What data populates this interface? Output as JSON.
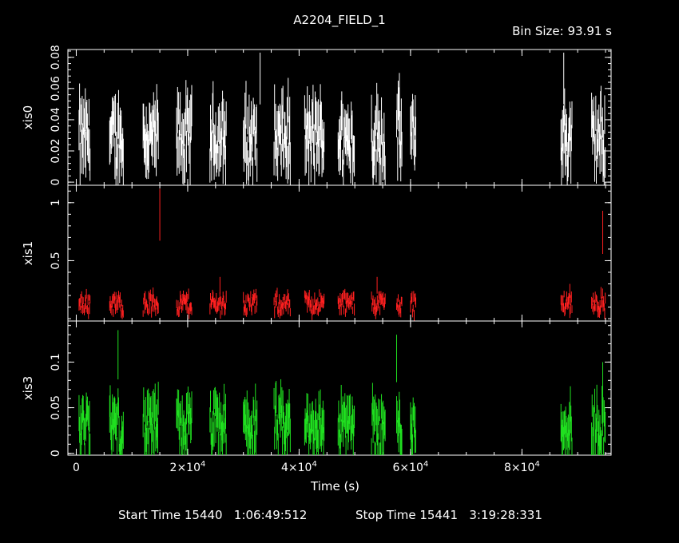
{
  "title": "A2204_FIELD_1",
  "bin_size": "Bin Size: 93.91 s",
  "x_label": "Time (s)",
  "start_label": "Start Time 15440   1:06:49:512",
  "stop_label": "Stop Time 15441   3:19:28:331",
  "colors": {
    "xis0": "#ffffff",
    "xis1": "#ff2020",
    "xis3": "#20e020",
    "frame": "#ffffff"
  },
  "chart_data": {
    "type": "scatter",
    "xlim": [
      -1500,
      96000
    ],
    "x_ticks": [
      {
        "v": 0,
        "label": "0"
      },
      {
        "v": 20000,
        "label": "2×10",
        "exp": "4"
      },
      {
        "v": 40000,
        "label": "4×10",
        "exp": "4"
      },
      {
        "v": 60000,
        "label": "6×10",
        "exp": "4"
      },
      {
        "v": 80000,
        "label": "8×10",
        "exp": "4"
      }
    ],
    "segments": [
      [
        500,
        2500
      ],
      [
        6000,
        8500
      ],
      [
        12000,
        14800
      ],
      [
        18000,
        20800
      ],
      [
        24000,
        27000
      ],
      [
        30000,
        32500
      ],
      [
        35500,
        38500
      ],
      [
        41000,
        44500
      ],
      [
        47000,
        50000
      ],
      [
        53000,
        55500
      ],
      [
        57500,
        58500
      ],
      [
        60000,
        61000
      ],
      [
        87000,
        89000
      ],
      [
        92500,
        95000
      ]
    ],
    "panels": [
      {
        "name": "xis0",
        "ylim": [
          -0.002,
          0.085
        ],
        "y_ticks": [
          0,
          0.02,
          0.04,
          0.06,
          0.08
        ],
        "y_tick_labels": [
          "0",
          "0.02",
          "0.04",
          "0.06",
          "0.08"
        ],
        "level": 0.028,
        "spread": 0.022,
        "err": 0.012,
        "spikes": [
          [
            33000,
            0.083
          ],
          [
            87500,
            0.083
          ],
          [
            58000,
            0.07
          ]
        ]
      },
      {
        "name": "xis1",
        "ylim": [
          -0.02,
          1.15
        ],
        "y_ticks": [
          0.5,
          1
        ],
        "y_tick_labels": [
          "0.5",
          "1"
        ],
        "level": 0.13,
        "spread": 0.09,
        "err": 0.04,
        "spikes": [
          [
            15000,
            1.12
          ],
          [
            94500,
            0.93
          ],
          [
            25800,
            0.36
          ],
          [
            54000,
            0.36
          ],
          [
            88600,
            0.3
          ]
        ]
      },
      {
        "name": "xis3",
        "ylim": [
          -0.002,
          0.145
        ],
        "y_ticks": [
          0,
          0.05,
          0.1
        ],
        "y_tick_labels": [
          "0",
          "0.05",
          "0.1"
        ],
        "level": 0.03,
        "spread": 0.03,
        "err": 0.016,
        "spikes": [
          [
            57500,
            0.13
          ],
          [
            7500,
            0.135
          ],
          [
            94500,
            0.1
          ]
        ]
      }
    ]
  }
}
